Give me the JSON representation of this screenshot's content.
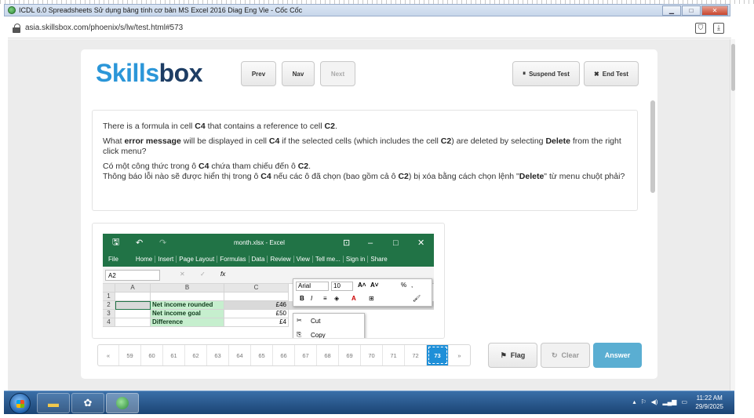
{
  "window": {
    "title": "ICDL 6.0 Spreadsheets Sử dụng bảng tính cơ bản MS Excel 2016 Diag Eng Vie - Cốc Cốc",
    "minimize": "▁",
    "maximize": "□",
    "close": "✕"
  },
  "address": {
    "url": "asia.skillsbox.com/phoenix/s/lw/test.html#573"
  },
  "logo": {
    "part1": "Skills",
    "part2": "box"
  },
  "toolbar": {
    "prev": "Prev",
    "nav": "Nav",
    "next": "Next",
    "suspend": "Suspend Test",
    "end": "End Test"
  },
  "question": {
    "en_line1_a": "There is a formula in cell ",
    "en_line1_b": "C4",
    "en_line1_c": " that contains a reference to cell ",
    "en_line1_d": "C2",
    "en_line1_e": ".",
    "en_line2_a": "What ",
    "en_line2_b": "error message",
    "en_line2_c": " will be displayed in cell ",
    "en_line2_d": "C4",
    "en_line2_e": " if the selected cells (which includes the cell ",
    "en_line2_f": "C2",
    "en_line2_g": ") are deleted by selecting ",
    "en_line2_h": "Delete",
    "en_line2_i": " from the right click menu?",
    "vi_line1_a": "Có một công thức trong ô ",
    "vi_line1_b": "C4",
    "vi_line1_c": " chứa tham chiếu đến ô ",
    "vi_line1_d": "C2",
    "vi_line1_e": ".",
    "vi_line2_a": "Thông báo lỗi nào sẽ được hiển thị trong ô ",
    "vi_line2_b": "C4",
    "vi_line2_c": " nếu các ô đã chọn (bao gồm cả ô ",
    "vi_line2_d": "C2",
    "vi_line2_e": ") bị xóa bằng cách chọn lệnh \"",
    "vi_line2_f": "Delete",
    "vi_line2_g": "\" từ menu chuột phải?"
  },
  "excel": {
    "filename": "month.xlsx - Excel",
    "tabs": [
      "File",
      "Home",
      "Insert",
      "Page Layout",
      "Formulas",
      "Data",
      "Review",
      "View",
      "Tell me...",
      "Sign in",
      "Share"
    ],
    "namebox": "A2",
    "columns": [
      "",
      "A",
      "B",
      "C"
    ],
    "rows": [
      {
        "num": "1",
        "a": "",
        "b": "",
        "c": ""
      },
      {
        "num": "2",
        "a": "",
        "b": "Net income rounded",
        "c": "£46"
      },
      {
        "num": "3",
        "a": "",
        "b": "Net income goal",
        "c": "£50"
      },
      {
        "num": "4",
        "a": "",
        "b": "Difference",
        "c": "£4"
      }
    ],
    "font_name": "Arial",
    "font_size": "10",
    "percent": "%",
    "comma": ",",
    "context_menu": [
      "Cut",
      "Copy"
    ]
  },
  "pager": {
    "prev": "«",
    "next": "»",
    "pages": [
      "59",
      "60",
      "61",
      "62",
      "63",
      "64",
      "65",
      "66",
      "67",
      "68",
      "69",
      "70",
      "71",
      "72",
      "73"
    ],
    "active": "73"
  },
  "actions": {
    "flag": "Flag",
    "clear": "Clear",
    "answer": "Answer"
  },
  "taskbar": {
    "time": "11:22 AM",
    "date": "29/9/2025"
  }
}
